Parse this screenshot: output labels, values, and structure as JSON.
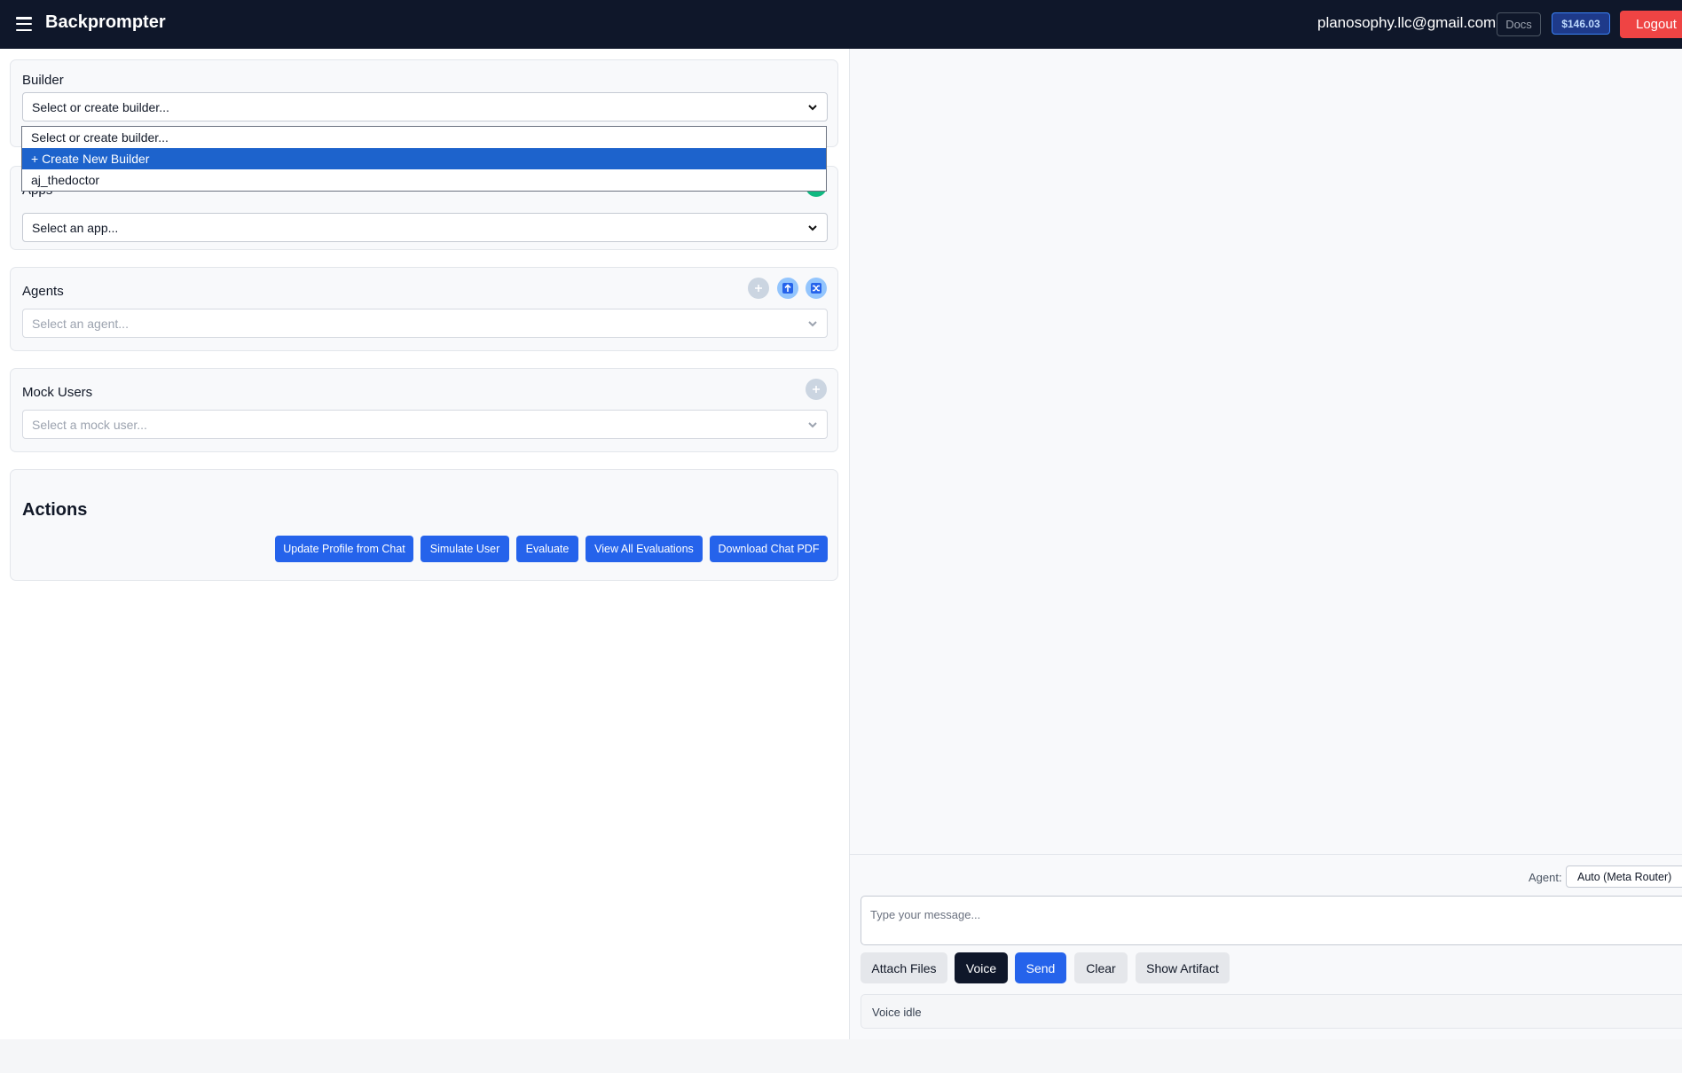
{
  "header": {
    "brand": "Backprompter",
    "user_email": "planosophy.llc@gmail.com",
    "docs_label": "Docs",
    "balance": "$146.03",
    "logout_label": "Logout"
  },
  "builder": {
    "title": "Builder",
    "selected": "Select or create builder...",
    "options": [
      "Select or create builder...",
      "+ Create New Builder",
      "aj_thedoctor"
    ],
    "highlighted_index": 1
  },
  "apps": {
    "title": "Apps",
    "selected": "Select an app..."
  },
  "agents": {
    "title": "Agents",
    "placeholder": "Select an agent..."
  },
  "mock_users": {
    "title": "Mock Users",
    "placeholder": "Select a mock user..."
  },
  "actions": {
    "title": "Actions",
    "buttons": [
      "Update Profile from Chat",
      "Simulate User",
      "Evaluate",
      "View All Evaluations",
      "Download Chat PDF"
    ]
  },
  "chat": {
    "agent_label": "Agent:",
    "agent_selected": "Auto (Meta Router)",
    "message_placeholder": "Type your message...",
    "attach_label": "Attach Files",
    "voice_label": "Voice",
    "send_label": "Send",
    "clear_label": "Clear",
    "artifact_label": "Show Artifact",
    "voice_status": "Voice idle"
  },
  "colors": {
    "topbar": "#0f172a",
    "primary": "#2563eb",
    "danger": "#ef4444",
    "success": "#10b981"
  }
}
